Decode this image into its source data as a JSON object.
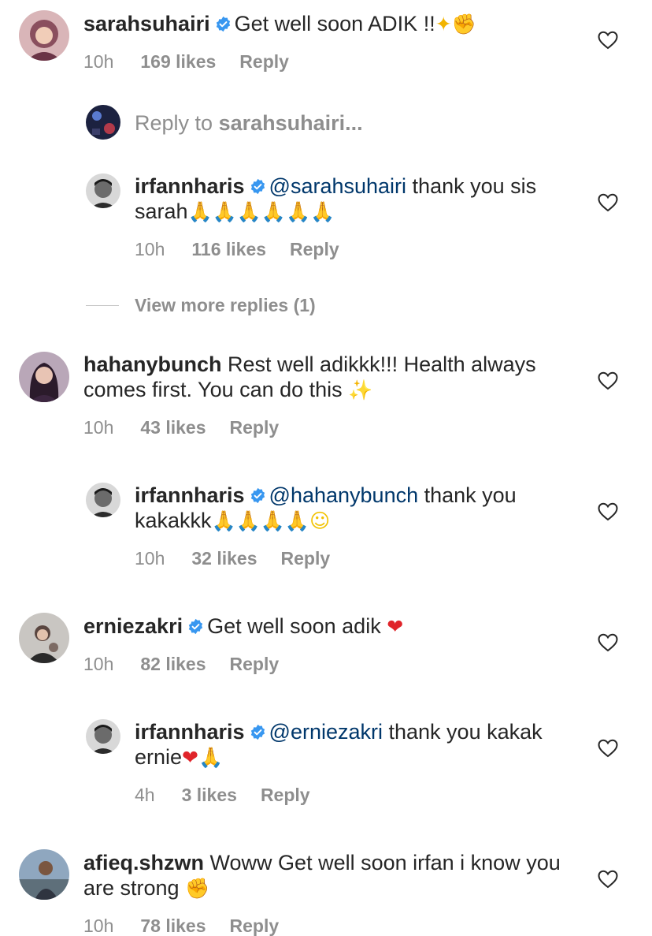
{
  "comments": [
    {
      "username": "sarahsuhairi",
      "verified": true,
      "text": "Get well soon ADIK !!",
      "emojis": [
        "dizzy-emoji",
        "flexed-biceps-emoji"
      ],
      "time": "10h",
      "likes": "169 likes",
      "reply": "Reply"
    },
    {
      "username": "irfannharis",
      "verified": true,
      "mention": "@sarahsuhairi",
      "text": " thank you sis sarah",
      "emojis": [
        "folded-hands-emoji x6"
      ],
      "time": "10h",
      "likes": "116 likes",
      "reply": "Reply"
    },
    {
      "username": "hahanybunch",
      "verified": false,
      "text": "Rest well adikkk!!! Health always comes first. You can do this ",
      "emojis": [
        "sparkles-emoji"
      ],
      "time": "10h",
      "likes": "43 likes",
      "reply": "Reply"
    },
    {
      "username": "irfannharis",
      "verified": true,
      "mention": "@hahanybunch",
      "text": " thank you kakakkk",
      "emojis": [
        "folded-hands-emoji x4",
        "pleading-face-emoji"
      ],
      "time": "10h",
      "likes": "32 likes",
      "reply": "Reply"
    },
    {
      "username": "erniezakri",
      "verified": true,
      "text": "Get well soon adik ",
      "emojis": [
        "red-heart-emoji"
      ],
      "time": "10h",
      "likes": "82 likes",
      "reply": "Reply"
    },
    {
      "username": "irfannharis",
      "verified": true,
      "mention": "@erniezakri",
      "text": " thank you kakak ernie",
      "emojis": [
        "red-heart-emoji",
        "folded-hands-emoji"
      ],
      "time": "4h",
      "likes": "3 likes",
      "reply": "Reply"
    },
    {
      "username": "afieq.shzwn",
      "verified": false,
      "text": "Woww Get well soon irfan i know you are strong ",
      "emojis": [
        "flexed-biceps-emoji"
      ],
      "time": "10h",
      "likes": "78 likes",
      "reply": "Reply"
    }
  ],
  "reply_box": {
    "prefix": "Reply to ",
    "target": "sarahsuhairi..."
  },
  "view_more": "View more replies (1)",
  "colors": {
    "text": "#262626",
    "muted": "#8e8e8e",
    "mention": "#00376b",
    "verified": "#3897f0"
  }
}
